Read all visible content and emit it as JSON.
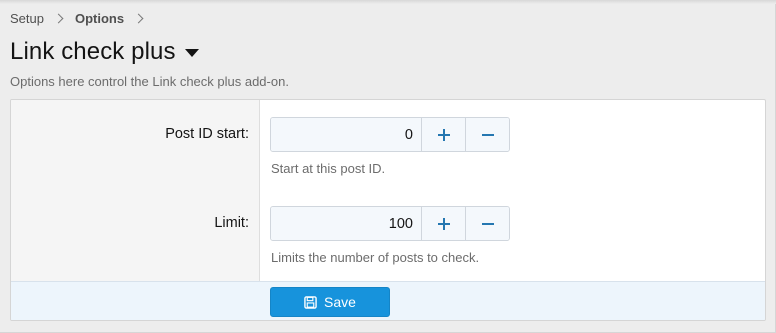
{
  "breadcrumb": [
    {
      "label": "Setup"
    },
    {
      "label": "Options"
    }
  ],
  "page": {
    "title": "Link check plus",
    "description": "Options here control the Link check plus add-on."
  },
  "form": {
    "fields": [
      {
        "label": "Post ID start:",
        "value": "0",
        "hint": "Start at this post ID."
      },
      {
        "label": "Limit:",
        "value": "100",
        "hint": "Limits the number of posts to check."
      }
    ],
    "save_label": "Save"
  },
  "colors": {
    "accent": "#1793dc",
    "stepper_icon": "#2577b1",
    "footer_bg": "#edf5fc"
  },
  "icons": {
    "increment": "plus-icon",
    "decrement": "minus-icon",
    "save": "floppy-disk-icon",
    "title_menu": "caret-down-icon",
    "breadcrumb_separator": "chevron-right-icon"
  }
}
